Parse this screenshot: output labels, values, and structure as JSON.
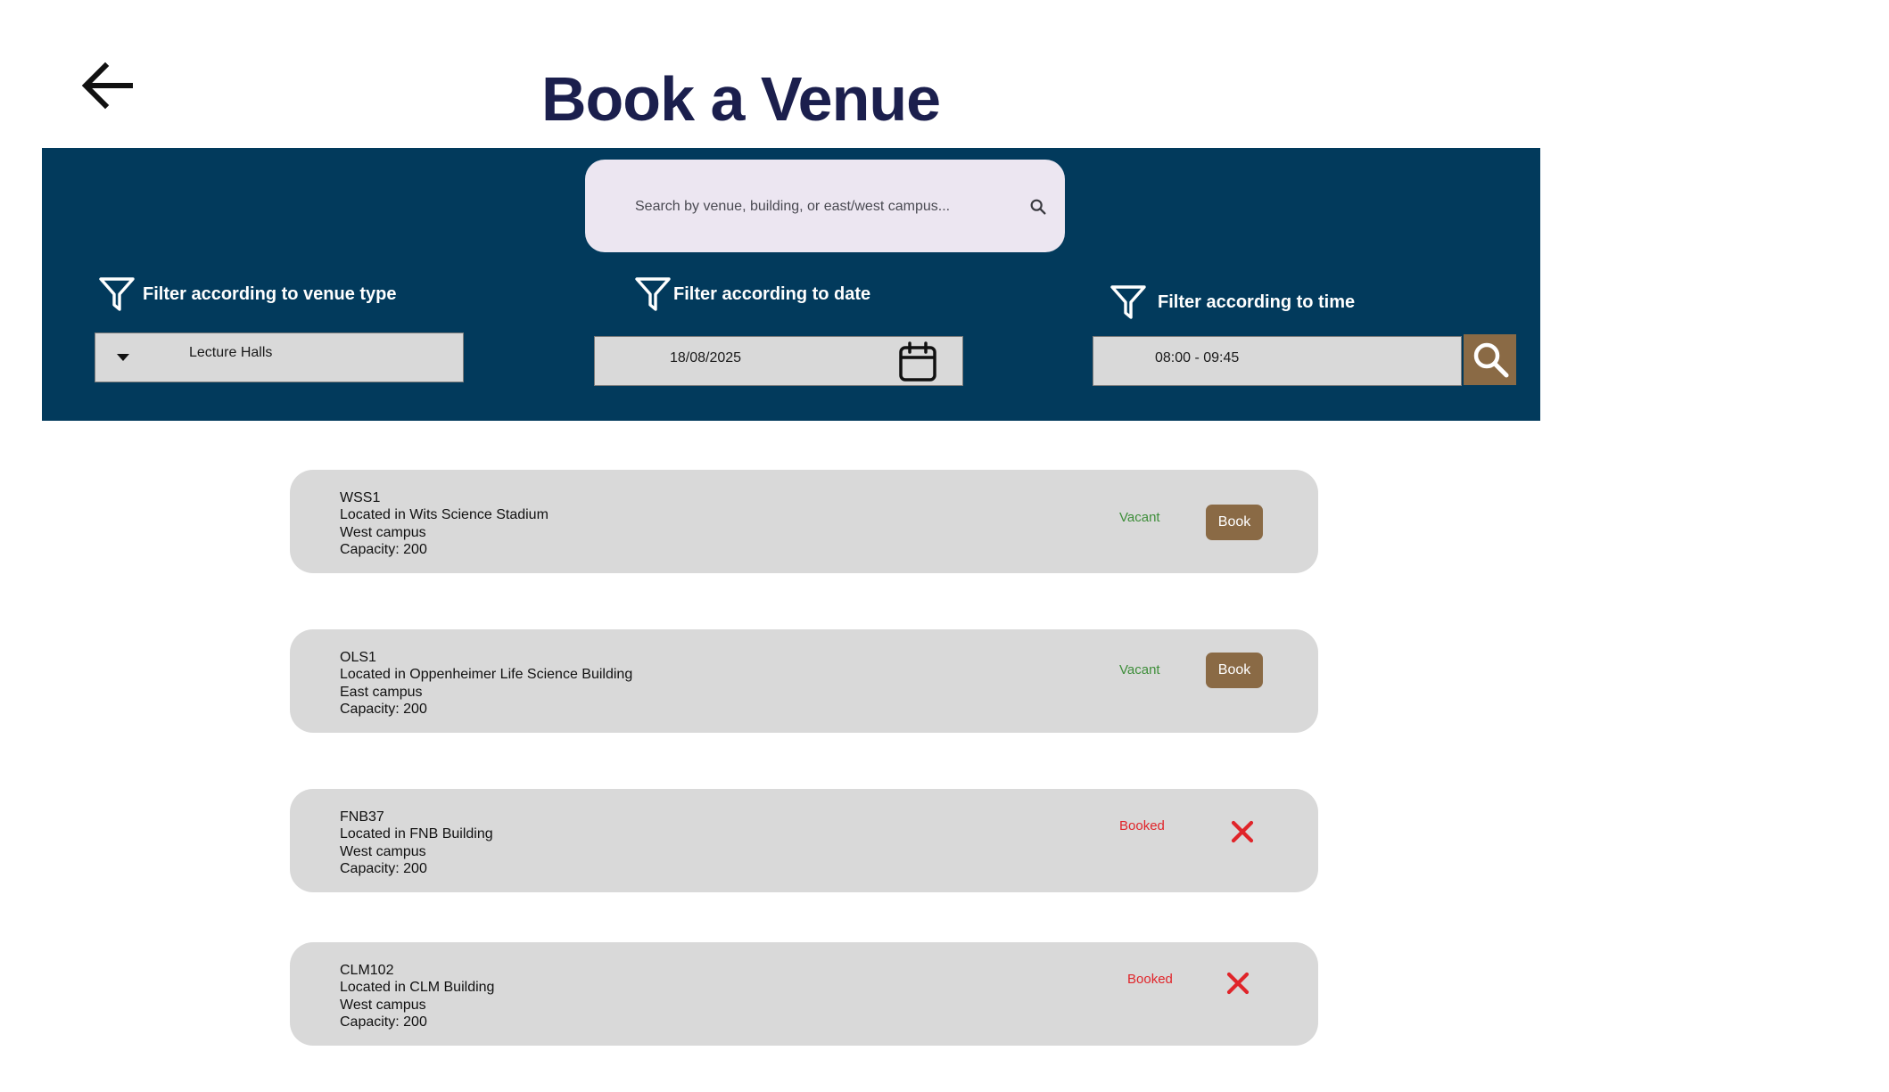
{
  "header": {
    "title": "Book a Venue",
    "back_icon": "arrow-left-icon"
  },
  "search": {
    "placeholder": "Search by venue, building, or east/west campus...",
    "icon": "search-icon"
  },
  "filters": {
    "venue_type": {
      "label": "Filter according to venue type",
      "value": "Lecture Halls",
      "icon": "funnel-icon"
    },
    "date": {
      "label": "Filter according to date",
      "value": "18/08/2025",
      "icon": "funnel-icon",
      "picker_icon": "calendar-icon"
    },
    "time": {
      "label": "Filter according to time",
      "value": "08:00 - 09:45",
      "icon": "funnel-icon"
    }
  },
  "search_button": {
    "icon": "search-icon"
  },
  "venues": [
    {
      "code": "WSS1",
      "location": "Located in Wits Science Stadium",
      "campus": "West campus",
      "capacity": "Capacity: 200",
      "status": "Vacant",
      "action": "Book"
    },
    {
      "code": "OLS1",
      "location": "Located in Oppenheimer Life Science Building",
      "campus": "East campus",
      "capacity": "Capacity: 200",
      "status": "Vacant",
      "action": "Book"
    },
    {
      "code": "FNB37",
      "location": "Located in FNB Building",
      "campus": "West campus",
      "capacity": "Capacity: 200",
      "status": "Booked",
      "action_icon": "close-icon"
    },
    {
      "code": "CLM102",
      "location": "Located in CLM Building",
      "campus": "West campus",
      "capacity": "Capacity: 200",
      "status": "Booked",
      "action_icon": "close-icon"
    }
  ],
  "colors": {
    "panel": "#023a5c",
    "title": "#1b1f4d",
    "accent": "#8a6a45",
    "card": "#d9d9d9",
    "vacant": "#3e8e3a",
    "booked": "#e0252a",
    "search_bg": "#ece6f1"
  }
}
